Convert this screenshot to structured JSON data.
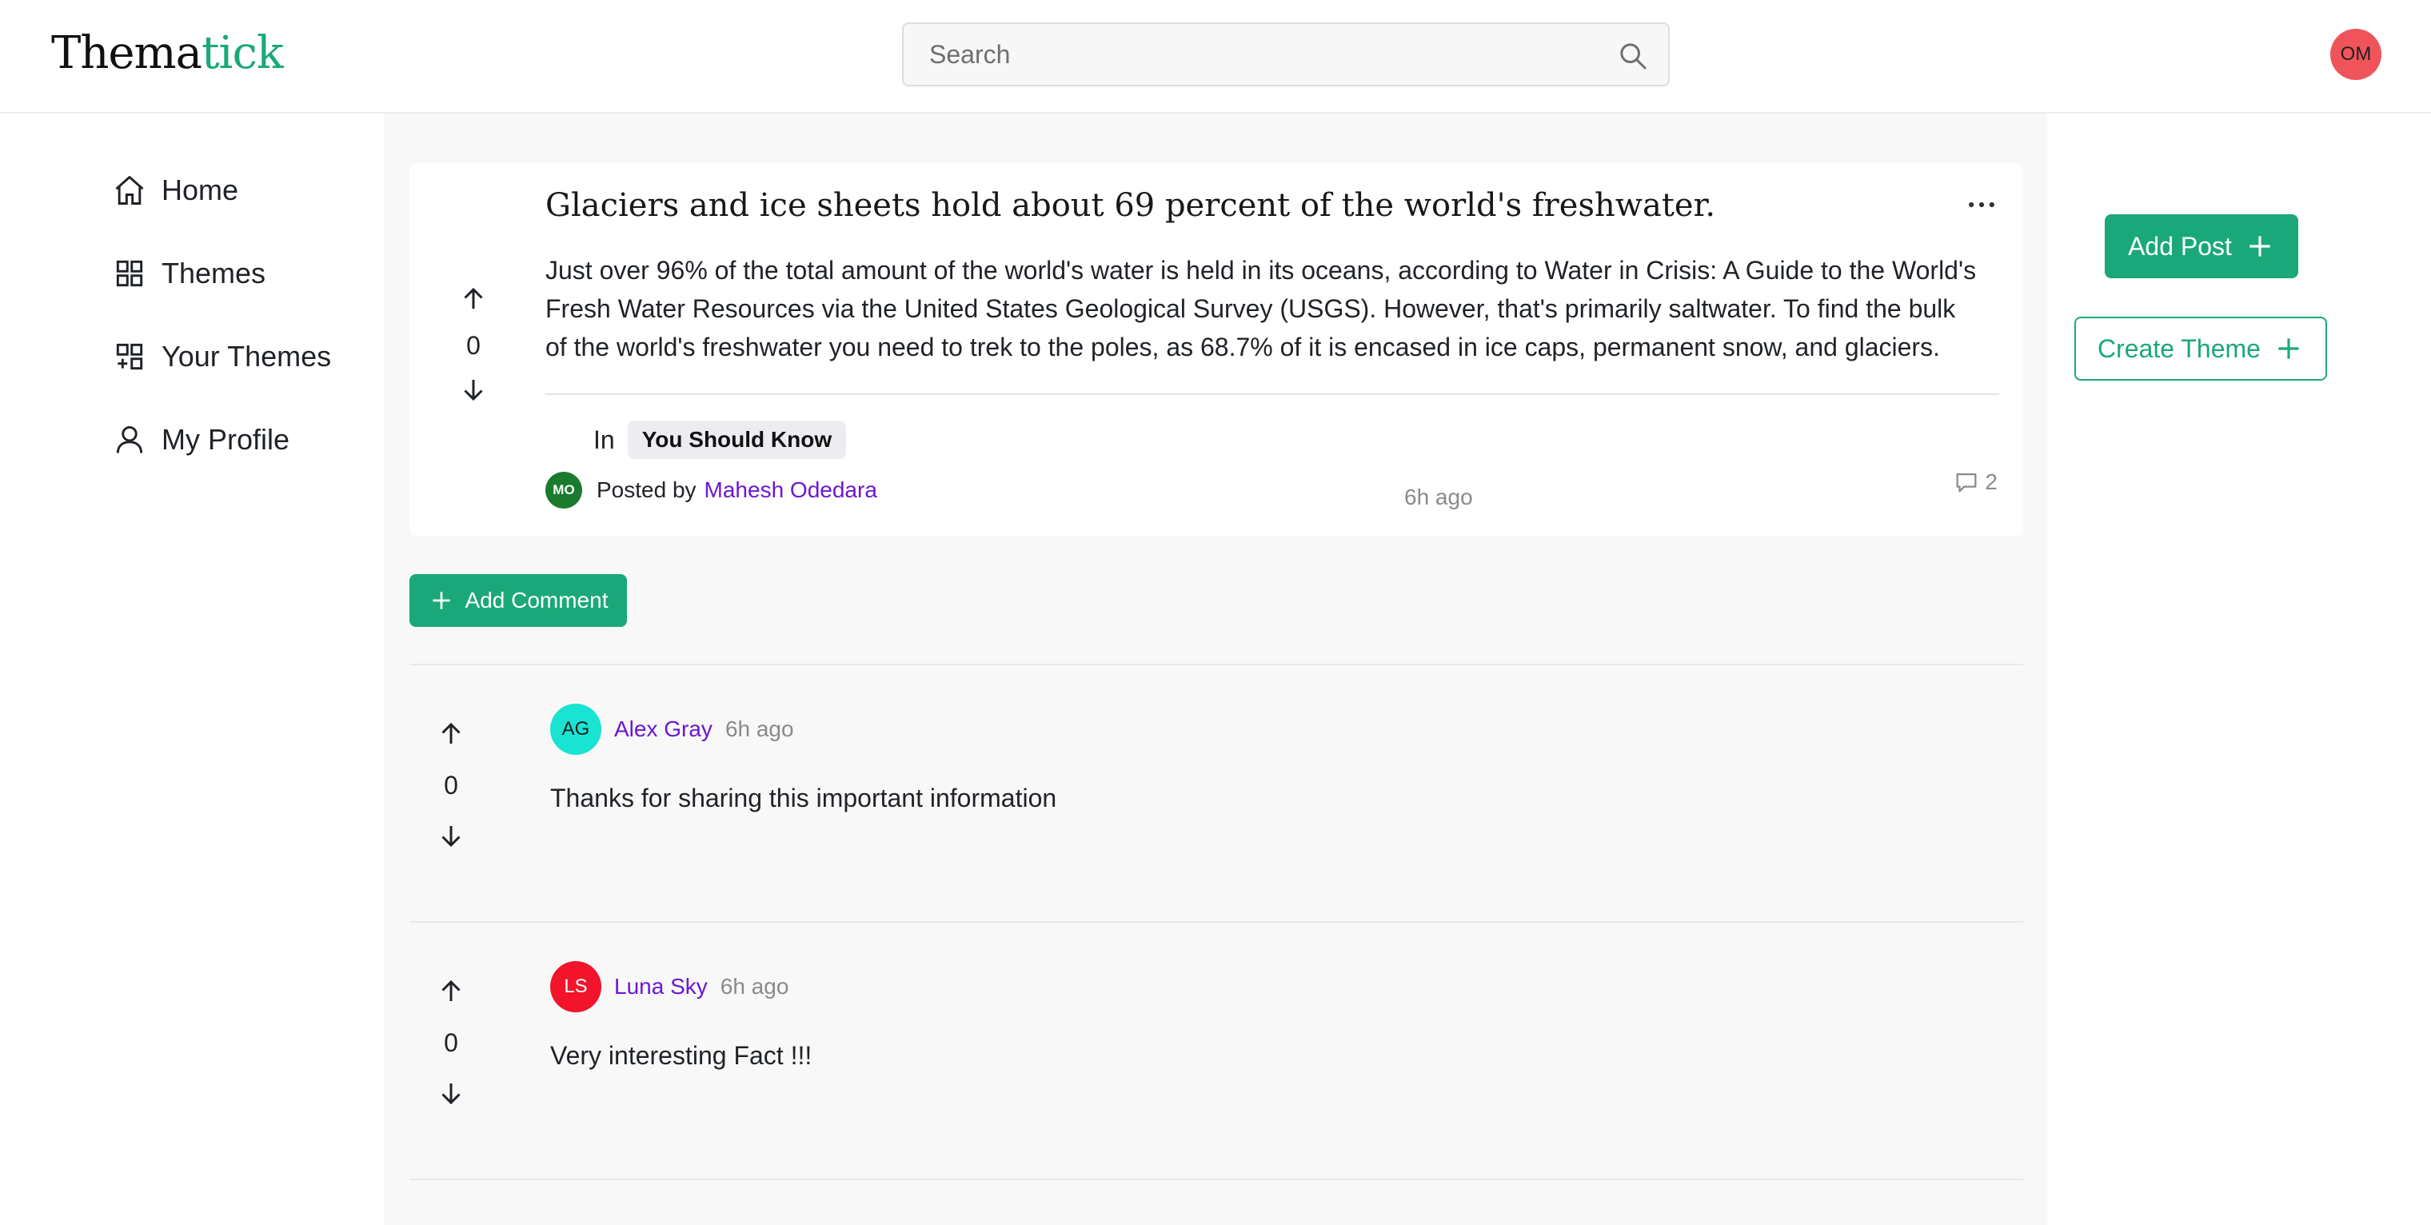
{
  "header": {
    "logo_left": "Thema",
    "logo_right": "tick",
    "search_placeholder": "Search",
    "user_initials": "OM"
  },
  "nav": {
    "items": [
      {
        "label": "Home",
        "icon": "home-icon"
      },
      {
        "label": "Themes",
        "icon": "grid-icon"
      },
      {
        "label": "Your Themes",
        "icon": "grid-plus-icon"
      },
      {
        "label": "My Profile",
        "icon": "user-icon"
      }
    ]
  },
  "post": {
    "title": "Glaciers and ice sheets hold about 69 percent of the world's freshwater.",
    "body": "Just over 96% of the total amount of the world's water is held in its oceans, according to Water in Crisis: A Guide to the World's Fresh Water Resources via the United States Geological Survey (USGS). However, that's primarily saltwater. To find the bulk of the world's freshwater you need to trek to the poles, as 68.7% of it is encased in ice caps, permanent snow, and glaciers.",
    "votes": "0",
    "in_label": "In",
    "theme": "You Should Know",
    "posted_by_label": "Posted by",
    "author": "Mahesh Odedara",
    "author_initials": "MO",
    "time": "6h ago",
    "comment_count": "2"
  },
  "actions": {
    "add_comment": "Add Comment",
    "add_post": "Add Post",
    "create_theme": "Create Theme"
  },
  "comments": [
    {
      "initials": "AG",
      "name": "Alex Gray",
      "time": "6h ago",
      "text": "Thanks for sharing this important information",
      "votes": "0",
      "avatar_color": "#19e3d2",
      "avatar_text_color": "#1f1f1f"
    },
    {
      "initials": "LS",
      "name": "Luna Sky",
      "time": "6h ago",
      "text": "Very interesting Fact !!!",
      "votes": "0",
      "avatar_color": "#f2142b",
      "avatar_text_color": "#ffffff"
    }
  ],
  "colors": {
    "brand": "#1aa87a",
    "link": "#6b17d4"
  }
}
